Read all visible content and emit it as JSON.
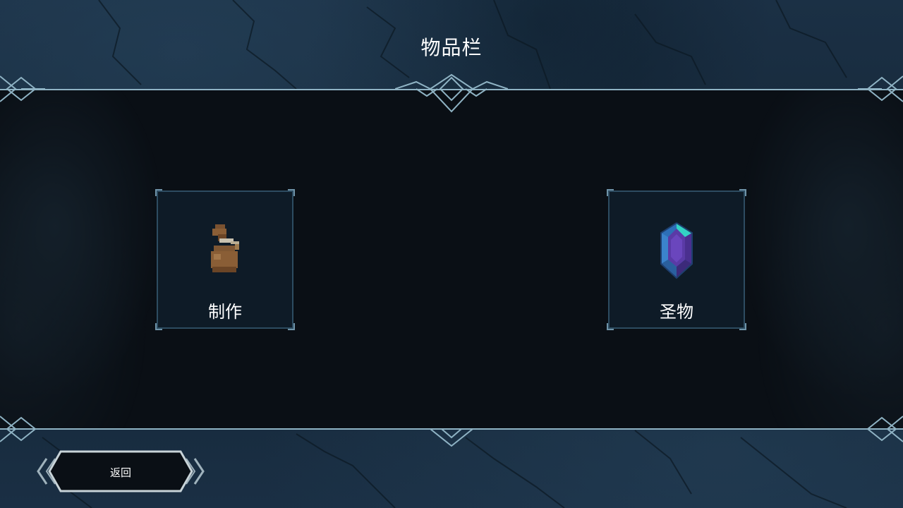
{
  "screen": {
    "title": "物品栏"
  },
  "categories": [
    {
      "label": "制作",
      "icon": "pouch-icon"
    },
    {
      "label": "圣物",
      "icon": "gem-icon"
    }
  ],
  "footer": {
    "back_label": "返回"
  },
  "colors": {
    "background": "#152535",
    "panel": "#0a0f15",
    "card": "#0e1b27",
    "border": "#2d4c61",
    "accent_line": "#8fb3c4",
    "text": "#ffffff"
  }
}
